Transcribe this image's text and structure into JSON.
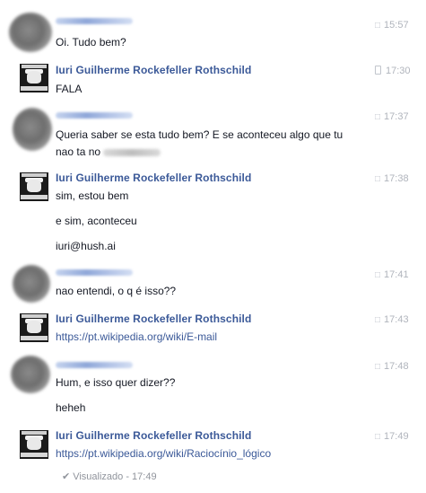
{
  "messages": [
    {
      "sender": "",
      "time": "15:57",
      "lines": [
        "Oi. Tudo bem?"
      ]
    },
    {
      "sender": "Iuri Guilherme Rockefeller Rothschild",
      "time": "17:30",
      "lines": [
        "FALA"
      ]
    },
    {
      "sender": "",
      "time": "17:37",
      "lines": [
        "Queria saber se esta tudo bem? E se aconteceu algo que tu",
        "nao ta no"
      ]
    },
    {
      "sender": "Iuri Guilherme Rockefeller Rothschild",
      "time": "17:38",
      "lines": [
        "sim, estou bem",
        "e sim, aconteceu",
        "iuri@hush.ai"
      ]
    },
    {
      "sender": "",
      "time": "17:41",
      "lines": [
        "nao entendi, o q é isso??"
      ]
    },
    {
      "sender": "Iuri Guilherme Rockefeller Rothschild",
      "time": "17:43",
      "lines": [
        "https://pt.wikipedia.org/wiki/E-mail"
      ]
    },
    {
      "sender": "",
      "time": "17:48",
      "lines": [
        "Hum, e isso quer dizer??",
        "heheh"
      ]
    },
    {
      "sender": "Iuri Guilherme Rockefeller Rothschild",
      "time": "17:49",
      "lines": [
        "https://pt.wikipedia.org/wiki/Raciocínio_lógico"
      ]
    }
  ],
  "seen_status": "Visualizado - 17:49",
  "icons": {
    "chat": "chat-bubble-icon",
    "mobile": "mobile-phone-icon",
    "check": "check-icon"
  },
  "colors": {
    "sender_name": "#3b5998",
    "timestamp": "#b0b4bc"
  }
}
